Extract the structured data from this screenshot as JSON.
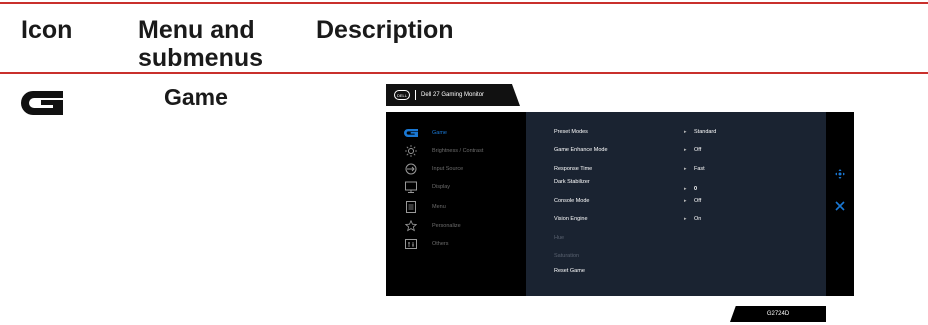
{
  "header": {
    "col_icon": "Icon",
    "col_menu": "Menu and submenus",
    "col_desc": "Description"
  },
  "row": {
    "icon_name": "game-g-icon",
    "menu": "Game"
  },
  "osd": {
    "brand": "DELL",
    "title": "Dell 27 Gaming Monitor",
    "menu_items": [
      {
        "label": "Game",
        "icon": "game-g-icon",
        "active": true
      },
      {
        "label": "Brightness / Contrast",
        "icon": "brightness-icon",
        "active": false
      },
      {
        "label": "Input Source",
        "icon": "input-source-icon",
        "active": false
      },
      {
        "label": "Display",
        "icon": "display-icon",
        "active": false
      },
      {
        "label": "Menu",
        "icon": "menu-icon",
        "active": false
      },
      {
        "label": "Personalize",
        "icon": "star-icon",
        "active": false
      },
      {
        "label": "Others",
        "icon": "others-icon",
        "active": false
      }
    ],
    "settings": [
      {
        "label": "Preset Modes",
        "value": "Standard",
        "arrow": "▸",
        "enabled": true
      },
      {
        "label": "Game Enhance Mode",
        "value": "Off",
        "arrow": "▸",
        "enabled": true
      },
      {
        "label": "Response Time",
        "value": "Fast",
        "arrow": "▸",
        "enabled": true
      },
      {
        "label": "Dark Stabilizer",
        "value": "0",
        "arrow": "▸",
        "enabled": true
      },
      {
        "label": "Console Mode",
        "value": "Off",
        "arrow": "▸",
        "enabled": true
      },
      {
        "label": "Vision Engine",
        "value": "On",
        "arrow": "▸",
        "enabled": true
      },
      {
        "label": "Hue",
        "value": "",
        "arrow": "",
        "enabled": false
      },
      {
        "label": "Saturation",
        "value": "",
        "arrow": "",
        "enabled": false
      },
      {
        "label": "Reset Game",
        "value": "",
        "arrow": "",
        "enabled": true
      }
    ],
    "model": "G2724D",
    "accent": "#1a78d4"
  }
}
